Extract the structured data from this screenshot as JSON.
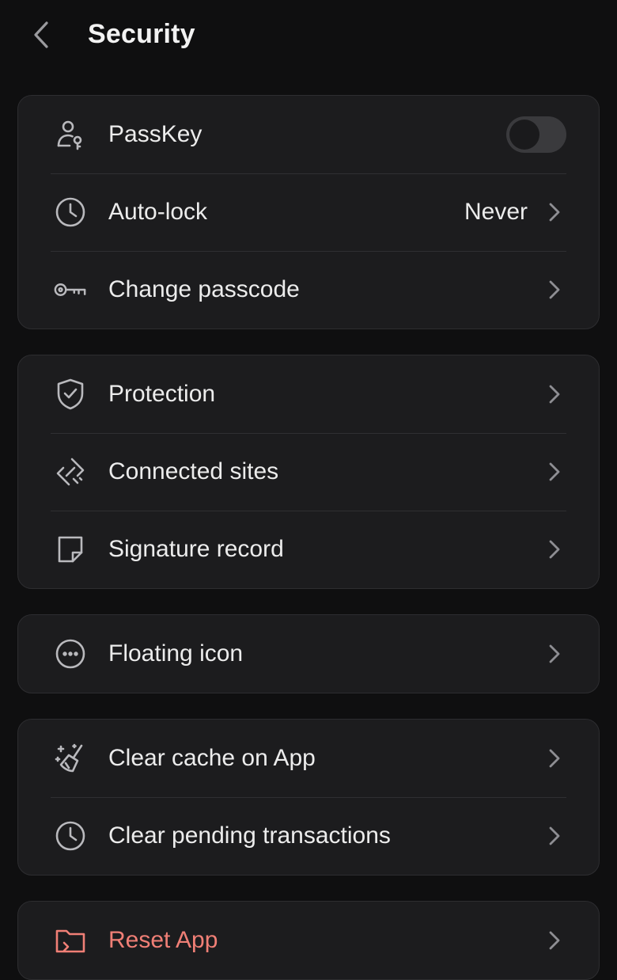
{
  "header": {
    "title": "Security",
    "back_icon": "back-chevron-icon"
  },
  "colors": {
    "background": "#0f0f10",
    "card": "#1c1c1e",
    "danger": "#f07f76"
  },
  "groups": [
    {
      "items": [
        {
          "label": "PassKey",
          "icon": "passkey-user-icon",
          "control": "toggle",
          "toggle_on": false
        },
        {
          "label": "Auto-lock",
          "icon": "clock-icon",
          "value": "Never"
        },
        {
          "label": "Change passcode",
          "icon": "key-icon"
        }
      ]
    },
    {
      "items": [
        {
          "label": "Protection",
          "icon": "shield-check-icon"
        },
        {
          "label": "Connected sites",
          "icon": "link-icon"
        },
        {
          "label": "Signature record",
          "icon": "note-icon"
        }
      ]
    },
    {
      "items": [
        {
          "label": "Floating icon",
          "icon": "more-circle-icon"
        }
      ]
    },
    {
      "items": [
        {
          "label": "Clear cache on App",
          "icon": "broom-icon"
        },
        {
          "label": "Clear pending transactions",
          "icon": "clock-icon"
        }
      ]
    },
    {
      "items": [
        {
          "label": "Reset App",
          "icon": "folder-icon",
          "danger": true
        }
      ]
    }
  ]
}
